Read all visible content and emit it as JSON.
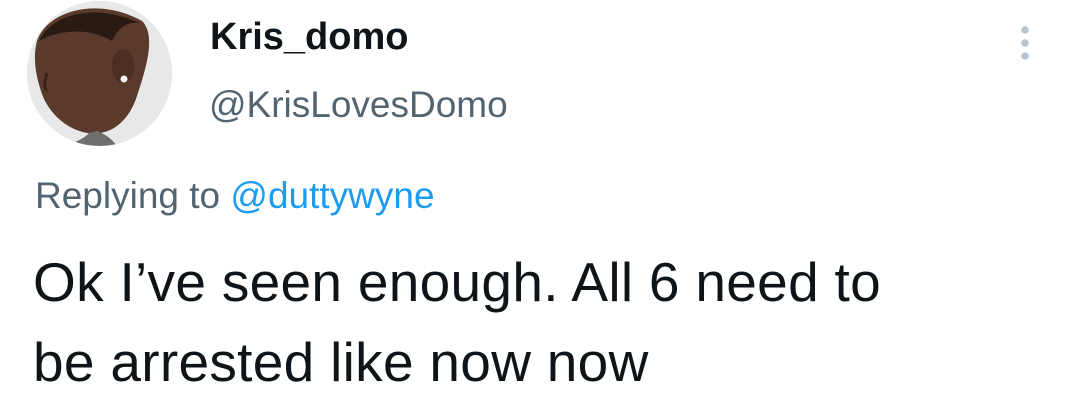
{
  "tweet": {
    "author": {
      "display_name": "Kris_domo",
      "handle": "@KrisLovesDomo"
    },
    "reply": {
      "prefix": "Replying to",
      "mention": "@duttywyne"
    },
    "text_lines": [
      "Ok I’ve seen enough. All 6 need to",
      "be arrested like now now"
    ],
    "menu_icon": "more-horizontal-icon",
    "colors": {
      "text_primary": "#0f1419",
      "text_secondary": "#536471",
      "link": "#1d9bf0",
      "menu_icon": "#b9c3cc"
    }
  }
}
